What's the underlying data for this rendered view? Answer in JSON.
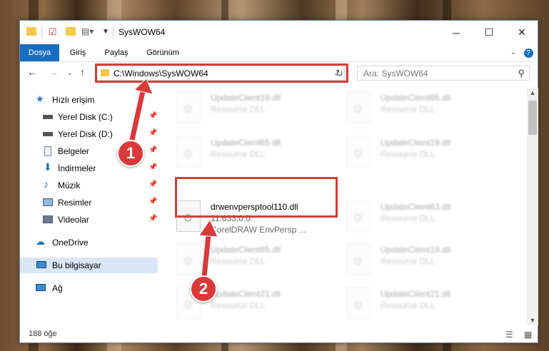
{
  "window": {
    "title": "SysWOW64"
  },
  "ribbon": {
    "tabs": [
      "Dosya",
      "Giriş",
      "Paylaş",
      "Görünüm"
    ]
  },
  "address": {
    "path": "C:\\Windows\\SysWOW64"
  },
  "search": {
    "placeholder": "Ara: SysWOW64"
  },
  "sidebar": {
    "quick_access": "Hızlı erişim",
    "items": [
      "Yerel Disk (C:)",
      "Yerel Disk (D:)",
      "Belgeler",
      "İndirmeler",
      "Müzik",
      "Resimler",
      "Videolar"
    ],
    "onedrive": "OneDrive",
    "this_pc": "Bu bilgisayar",
    "network": "Ağ"
  },
  "files": {
    "highlighted": {
      "name": "drwenvpersptool110.dll",
      "version": "11.633.0.0",
      "desc": "CorelDRAW EnvPersp ..."
    },
    "blurred": [
      {
        "name": "UpdateClient19.dll",
        "desc": "Resource DLL"
      },
      {
        "name": "UpdateClient65.dll",
        "desc": "Resource DLL"
      },
      {
        "name": "UpdateClient65.dll",
        "desc": "Resource DLL"
      },
      {
        "name": "UpdateClient19.dll",
        "desc": "Resource DLL"
      },
      {
        "name": "UpdateClient63.dll",
        "desc": "Resource DLL"
      },
      {
        "name": "UpdateClient65.dll",
        "desc": "Resource DLL"
      },
      {
        "name": "UpdateClient19.dll",
        "desc": "Resource DLL"
      },
      {
        "name": "UpdateClient21.dll",
        "desc": "Resource DLL"
      },
      {
        "name": "UpdateClient21.dll",
        "desc": "Resource DLL"
      }
    ]
  },
  "status": {
    "count": "188 öğe"
  },
  "markers": [
    "1",
    "2"
  ],
  "colors": {
    "accent": "#1a6ec0",
    "highlight": "#d53c3c"
  }
}
